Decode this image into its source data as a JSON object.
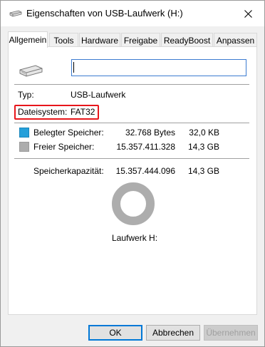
{
  "window": {
    "title": "Eigenschaften von USB-Laufwerk (H:)"
  },
  "tabs": [
    {
      "label": "Allgemein",
      "active": true
    },
    {
      "label": "Tools",
      "active": false
    },
    {
      "label": "Hardware",
      "active": false
    },
    {
      "label": "Freigabe",
      "active": false
    },
    {
      "label": "ReadyBoost",
      "active": false
    },
    {
      "label": "Anpassen",
      "active": false
    }
  ],
  "general": {
    "name_value": "",
    "type_label": "Typ:",
    "type_value": "USB-Laufwerk",
    "fs_label": "Dateisystem:",
    "fs_value": "FAT32",
    "used_label": "Belegter Speicher:",
    "used_bytes": "32.768 Bytes",
    "used_size": "32,0 KB",
    "free_label": "Freier Speicher:",
    "free_bytes": "15.357.411.328",
    "free_size": "14,3 GB",
    "capacity_label": "Speicherkapazität:",
    "capacity_bytes": "15.357.444.096",
    "capacity_size": "14,3 GB",
    "drive_label": "Laufwerk H:",
    "used_fraction": 2.1e-06
  },
  "colors": {
    "used": "#26a0da",
    "free": "#adadad",
    "highlight": "#e8161b"
  },
  "buttons": {
    "ok": "OK",
    "cancel": "Abbrechen",
    "apply": "Übernehmen"
  }
}
